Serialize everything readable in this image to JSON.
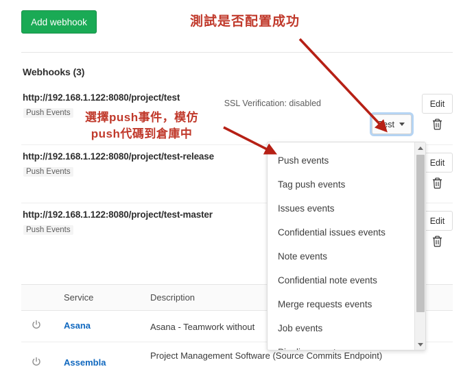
{
  "toolbar": {
    "add_webhook_label": "Add webhook"
  },
  "webhooks_section": {
    "title": "Webhooks (3)",
    "rows": [
      {
        "url": "http://192.168.1.122:8080/project/test",
        "badge": "Push Events",
        "ssl": "SSL Verification: disabled",
        "edit_label": "Edit",
        "test_label": "Test",
        "delete_icon": "trash-icon"
      },
      {
        "url": "http://192.168.1.122:8080/project/test-release",
        "badge": "Push Events",
        "edit_label": "Edit",
        "delete_icon": "trash-icon"
      },
      {
        "url": "http://192.168.1.122:8080/project/test-master",
        "badge": "Push Events",
        "edit_label": "Edit",
        "delete_icon": "trash-icon"
      }
    ]
  },
  "test_dropdown": {
    "items": [
      "Push events",
      "Tag push events",
      "Issues events",
      "Confidential issues events",
      "Note events",
      "Confidential note events",
      "Merge requests events",
      "Job events",
      "Pipeline events"
    ],
    "scroll_up_icon": "chevron-up-icon",
    "scroll_down_icon": "chevron-down-icon"
  },
  "services_table": {
    "columns": {
      "service": "Service",
      "description": "Description"
    },
    "rows": [
      {
        "toggle_icon": "power-icon",
        "name": "Asana",
        "description": "Asana - Teamwork without"
      },
      {
        "toggle_icon": "power-icon",
        "name": "Assembla",
        "description": "Project Management Software (Source Commits Endpoint)"
      }
    ]
  },
  "annotations": {
    "note_test": "測試是否配置成功",
    "note_push_line1": "選擇push事件，模仿",
    "note_push_line2": "push代碼到倉庫中",
    "color": "#c0392b"
  }
}
